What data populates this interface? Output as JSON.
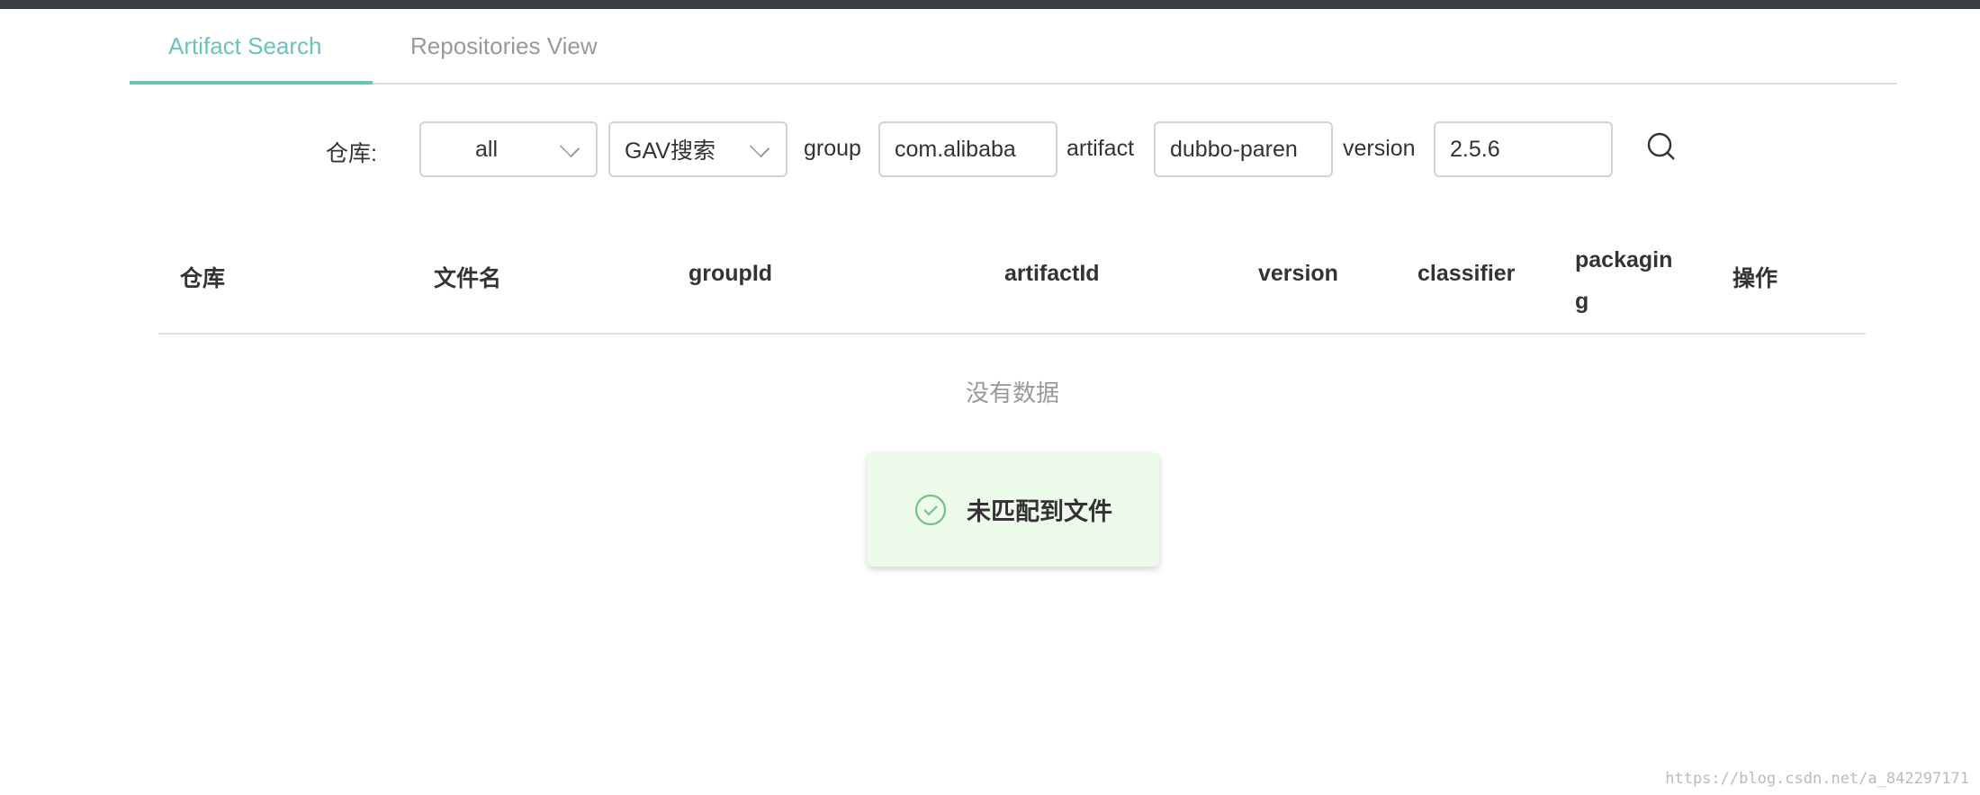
{
  "tabs": [
    {
      "label": "Artifact Search",
      "active": true
    },
    {
      "label": "Repositories View",
      "active": false
    }
  ],
  "filters": {
    "repo_label": "仓库:",
    "repo_select": "all",
    "mode_select": "GAV搜索",
    "group_label": "group",
    "group_value": "com.alibaba",
    "artifact_label": "artifact",
    "artifact_value": "dubbo-paren",
    "version_label": "version",
    "version_value": "2.5.6",
    "search_icon": "search-icon"
  },
  "table": {
    "columns": [
      "仓库",
      "文件名",
      "groupId",
      "artifactId",
      "version",
      "classifier",
      "packagin\ng",
      "操作"
    ],
    "empty_text": "没有数据"
  },
  "toast": {
    "text": "未匹配到文件",
    "icon": "check-circle-icon",
    "color": "#7cbf86"
  },
  "watermark": "https://blog.csdn.net/a_842297171",
  "colors": {
    "accent": "#6cc3bc",
    "topbar": "#3a3d42",
    "toast_bg": "#edfcea"
  }
}
